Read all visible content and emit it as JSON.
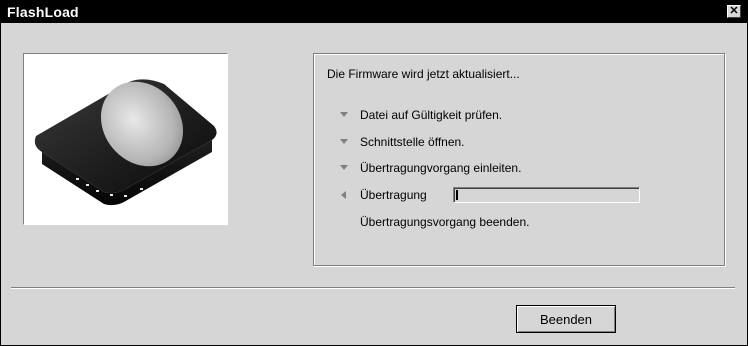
{
  "window": {
    "title": "FlashLoad"
  },
  "icons": {
    "close": "close-icon",
    "step_done": "triangle-down-icon",
    "step_active": "triangle-left-icon"
  },
  "status": {
    "intro": "Die Firmware wird jetzt aktualisiert...",
    "steps": [
      {
        "label": "Datei auf Gültigkeit prüfen.",
        "state": "done"
      },
      {
        "label": "Schnittstelle öffnen.",
        "state": "done"
      },
      {
        "label": "Übertragungvorgang einleiten.",
        "state": "done"
      },
      {
        "label": "Übertragung",
        "state": "active"
      },
      {
        "label": "Übertragungsvorgang beenden.",
        "state": "pending"
      }
    ],
    "transfer_progress_percent": 1
  },
  "buttons": {
    "finish": "Beenden"
  },
  "colors": {
    "titlebar": "#000000",
    "face": "#d6d6d6",
    "shadow": "#808080",
    "highlight": "#ffffff"
  }
}
